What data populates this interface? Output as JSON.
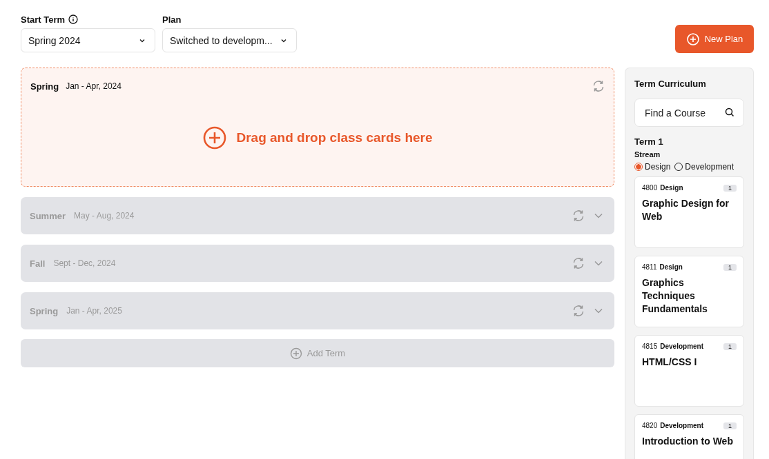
{
  "filters": {
    "start_term": {
      "label": "Start Term",
      "value": "Spring 2024"
    },
    "plan": {
      "label": "Plan",
      "value": "Switched to developm..."
    }
  },
  "new_plan_button": "New Plan",
  "terms": [
    {
      "season": "Spring",
      "dates": "Jan -  Apr, 2024",
      "expanded": true,
      "drop_hint": "Drag and drop class cards here"
    },
    {
      "season": "Summer",
      "dates": "May - Aug, 2024",
      "expanded": false
    },
    {
      "season": "Fall",
      "dates": "Sept - Dec, 2024",
      "expanded": false
    },
    {
      "season": "Spring",
      "dates": "Jan -  Apr, 2025",
      "expanded": false
    }
  ],
  "add_term_button": "Add Term",
  "curriculum": {
    "title": "Term Curriculum",
    "search": {
      "placeholder": "Find a Course"
    },
    "term": "Term 1",
    "stream_label": "Stream",
    "streams": [
      {
        "label": "Design",
        "selected": true
      },
      {
        "label": "Development",
        "selected": false
      }
    ],
    "courses": [
      {
        "code": "4800",
        "stream": "Design",
        "credits": "1",
        "title": "Graphic Design for Web"
      },
      {
        "code": "4811",
        "stream": "Design",
        "credits": "1",
        "title": "Graphics Techniques Fundamentals"
      },
      {
        "code": "4815",
        "stream": "Development",
        "credits": "1",
        "title": "HTML/CSS I"
      },
      {
        "code": "4820",
        "stream": "Development",
        "credits": "1",
        "title": "Introduction to Web"
      }
    ]
  }
}
